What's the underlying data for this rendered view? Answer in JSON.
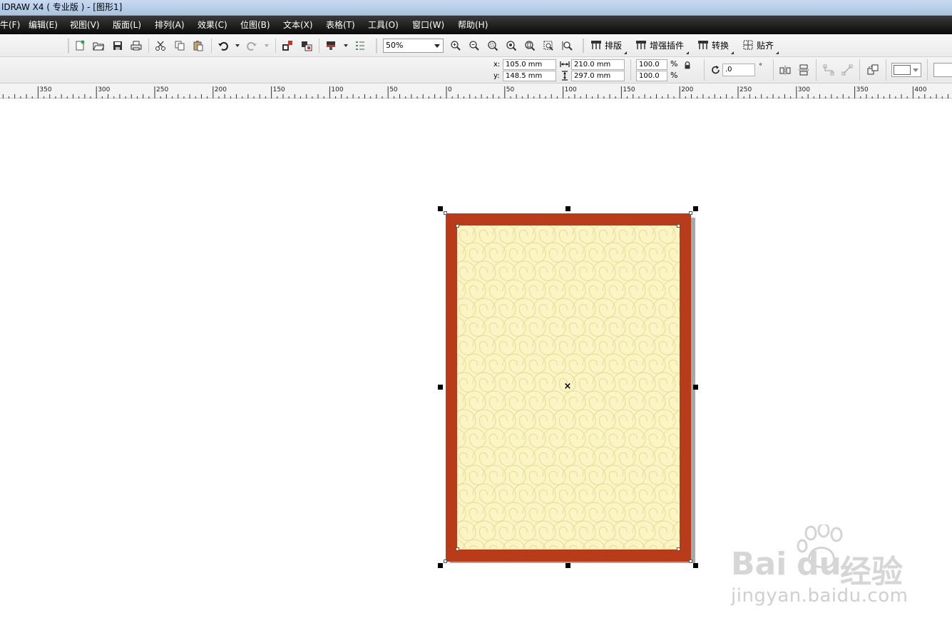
{
  "titlebar": {
    "title": "lDRAW X4 ( 专业版 ) - [图形1]"
  },
  "menubar": {
    "items": [
      "牛(F)",
      "编辑(E)",
      "视图(V)",
      "版面(L)",
      "排列(A)",
      "效果(C)",
      "位图(B)",
      "文本(X)",
      "表格(T)",
      "工具(O)",
      "窗口(W)",
      "帮助(H)"
    ]
  },
  "toolbar": {
    "zoom_value": "50%",
    "layout_label": "排版",
    "plugin_label": "增强插件",
    "convert_label": "转换",
    "snap_label": "贴齐"
  },
  "propbar": {
    "x_label": "x:",
    "y_label": "y:",
    "x_value": "105.0 mm",
    "y_value": "148.5 mm",
    "width_value": "210.0 mm",
    "height_value": "297.0 mm",
    "scale_w": "100.0",
    "scale_h": "100.0",
    "percent": "%",
    "rotation": ".0",
    "degree": "°"
  },
  "ruler": {
    "labels": [
      "350",
      "300",
      "250",
      "200",
      "150",
      "100",
      "50",
      "0",
      "50",
      "100",
      "150",
      "200",
      "250",
      "300",
      "350",
      "400"
    ]
  },
  "watermark": {
    "brand_left": "Bai",
    "brand_mid": "du",
    "brand_cn": "经验",
    "url": "jingyan.baidu.com"
  },
  "colors": {
    "page_border": "#b93c1a",
    "page_fill": "#fbf4c4",
    "pattern_stroke": "#e6dc96"
  }
}
